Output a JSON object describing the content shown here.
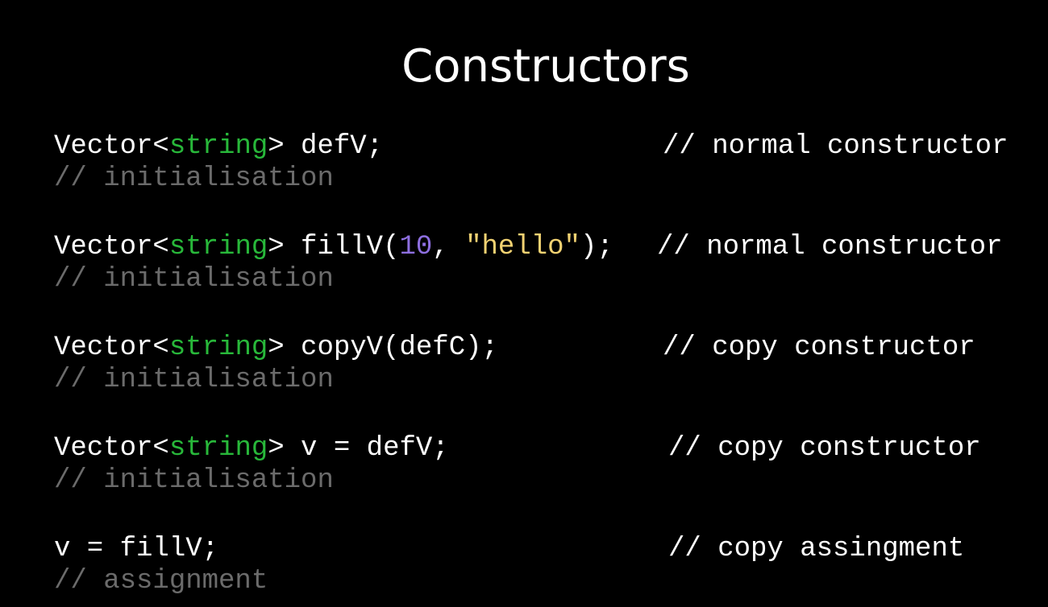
{
  "title": "Constructors",
  "colors": {
    "background": "#000000",
    "text": "#ffffff",
    "type_keyword": "#28b83a",
    "number_literal": "#8e6fe0",
    "string_literal": "#f2d272",
    "comment_dim": "#6b6b6b"
  },
  "lines": [
    {
      "code": {
        "type": "Vector",
        "lt": "<",
        "param": "string",
        "gt": ">",
        "rest": " defV;"
      },
      "comment": "// normal constructor",
      "note": "// initialisation"
    },
    {
      "code": {
        "type": "Vector",
        "lt": "<",
        "param": "string",
        "gt": ">",
        "rest_a": " fillV(",
        "num": "10",
        "sep": ", ",
        "str": "\"hello\"",
        "rest_b": ");"
      },
      "comment": "// normal constructor",
      "note": "// initialisation"
    },
    {
      "code": {
        "type": "Vector",
        "lt": "<",
        "param": "string",
        "gt": ">",
        "rest": " copyV(defC);"
      },
      "comment": "// copy constructor",
      "note": "// initialisation"
    },
    {
      "code": {
        "type": "Vector",
        "lt": "<",
        "param": "string",
        "gt": ">",
        "rest": " v = defV;"
      },
      "comment": "// copy constructor",
      "note": "// initialisation"
    },
    {
      "code": {
        "text": "v = fillV;"
      },
      "comment": "// copy assingment",
      "note": "// assignment"
    }
  ]
}
